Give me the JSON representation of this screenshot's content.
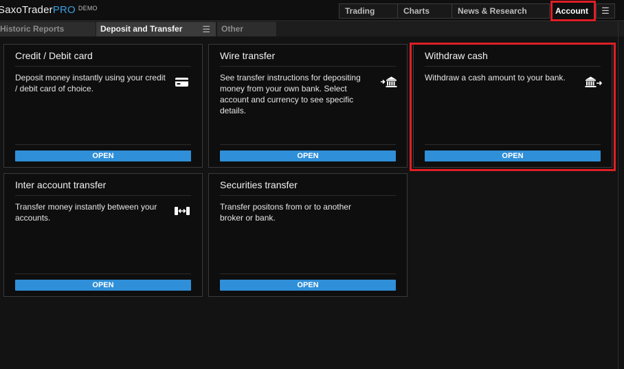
{
  "brand": {
    "name": "SaxoTrader",
    "edition": "PRO",
    "mode": "DEMO"
  },
  "topnav": {
    "items": [
      {
        "label": "Trading"
      },
      {
        "label": "Charts"
      },
      {
        "label": "News & Research"
      },
      {
        "label": "Account",
        "active": true
      }
    ],
    "menu_icon": "hamburger-icon"
  },
  "subtabs": [
    {
      "label": "Historic Reports"
    },
    {
      "label": "Deposit and Transfer",
      "active": true
    },
    {
      "label": "Other"
    }
  ],
  "cards": [
    {
      "title": "Credit / Debit card",
      "description": "Deposit money instantly using your credit / debit card of choice.",
      "icon": "credit-card-icon",
      "button": "OPEN"
    },
    {
      "title": "Wire transfer",
      "description": "See transfer instructions for depositing money from your own bank. Select account and currency to see specific details.",
      "icon": "bank-deposit-icon",
      "button": "OPEN"
    },
    {
      "title": "Withdraw cash",
      "description": "Withdraw a cash amount to your bank.",
      "icon": "bank-withdraw-icon",
      "button": "OPEN"
    },
    {
      "title": "Inter account transfer",
      "description": "Transfer money instantly between your accounts.",
      "icon": "inter-account-transfer-icon",
      "button": "OPEN"
    },
    {
      "title": "Securities transfer",
      "description": "Transfer positons from or to another broker or bank.",
      "icon": "",
      "button": "OPEN"
    }
  ],
  "colors": {
    "accent": "#2f8fd8",
    "highlight": "#e01e25",
    "background": "#131313"
  }
}
